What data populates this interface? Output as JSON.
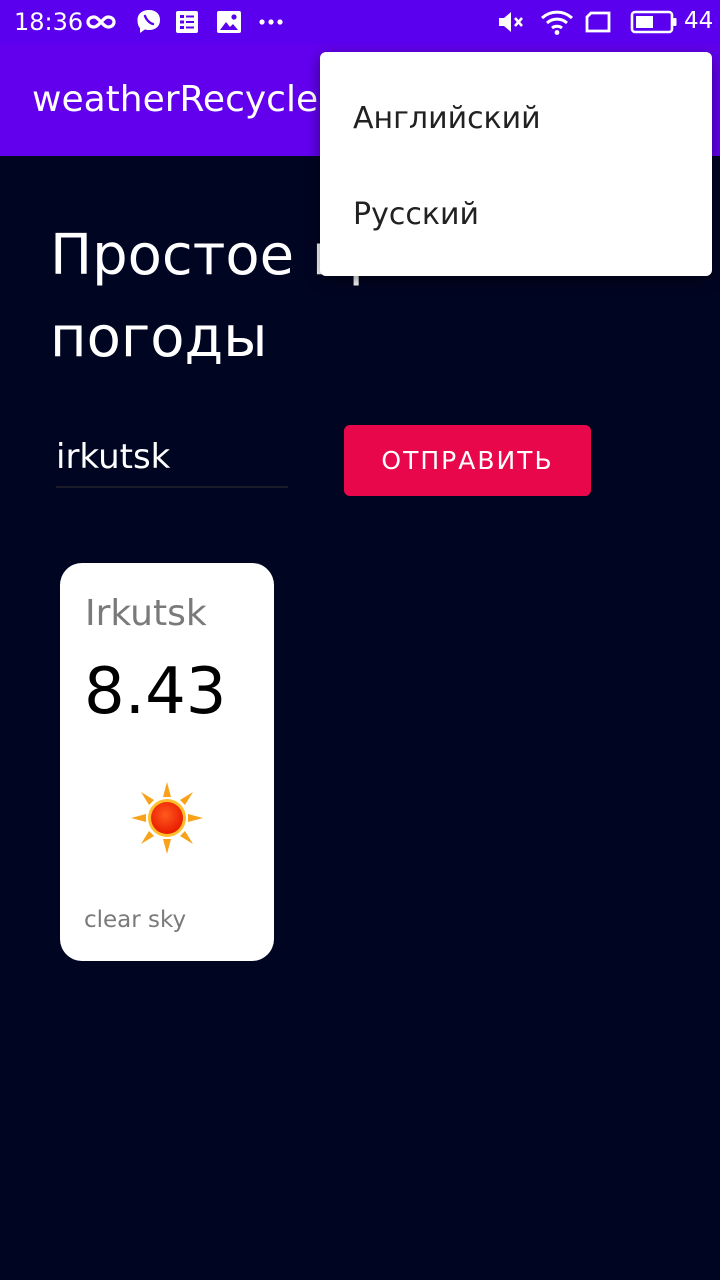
{
  "status_bar": {
    "time": "18:36",
    "battery_level": "44",
    "background_color": "#5b00ee",
    "left_icons": [
      "infinity-icon",
      "viber-icon",
      "news-icon",
      "gallery-icon",
      "more-dots-icon"
    ],
    "right_icons": [
      "mute-icon",
      "wifi-icon",
      "screen-icon",
      "battery-icon"
    ]
  },
  "app_bar": {
    "title": "weatherRecycle",
    "background_color": "#6200ee"
  },
  "main": {
    "heading": "Простое приложение погоды",
    "city_input": {
      "value": "irkutsk",
      "placeholder": ""
    },
    "send_button_label": "ОТПРАВИТЬ",
    "send_button_color": "#e8074b",
    "background_color": "#000522"
  },
  "weather_card": {
    "city": "Irkutsk",
    "temperature": "8.43",
    "icon": "sun-icon",
    "description": "clear sky"
  },
  "language_menu": {
    "items": [
      {
        "label": "Английский"
      },
      {
        "label": "Русский"
      }
    ]
  }
}
